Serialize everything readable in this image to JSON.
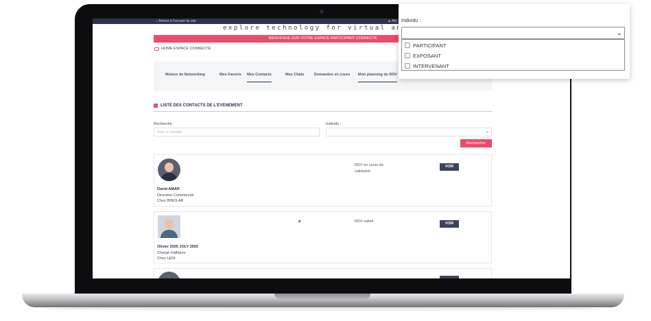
{
  "site": {
    "back_link": "Retour à l'accueil du site",
    "account": "Mo",
    "tagline": "explore technology for virtual and hybrid ev",
    "welcome_banner": "BIENVENUE SUR VOTRE ESPACE PARTICIPANT CONNECTÉ",
    "home_link": "HOME ESPACE CONNECTÉ",
    "accent_color": "#ee4a6a",
    "navy_color": "#2e3349"
  },
  "nav": {
    "tabs": [
      {
        "label": "Moteur de Networking"
      },
      {
        "label": "Mes Favoris"
      },
      {
        "label": "Mes Contacts",
        "active": true
      },
      {
        "label": "Mes Chats"
      },
      {
        "label": "Demandes en cours"
      },
      {
        "label": "Mon planning de RDV",
        "active": true
      }
    ]
  },
  "section": {
    "title": "LISTE DES CONTACTS DE L'EVENEMENT"
  },
  "filters": {
    "search_label": "Recherche :",
    "search_placeholder": "Nom ou Société",
    "individu_label": "Individu :",
    "search_button": "Rechercher"
  },
  "contacts": [
    {
      "name": "David AMAR",
      "title": "Directeur Commercial",
      "company": "Chez BINOLAR",
      "status": "RDV en cours de validation",
      "marker": "",
      "button": "VOIR"
    },
    {
      "name": "Olivier 2505 JOLY 2505",
      "title": "Chargé d'affaires",
      "company": "Chez LENI",
      "status": "RDV validé",
      "marker": "P",
      "button": "VOIR"
    }
  ],
  "dropdown": {
    "label": "Individu :",
    "options": [
      {
        "label": "PARTICIPANT"
      },
      {
        "label": "EXPOSANT"
      },
      {
        "label": "INTERVENANT"
      }
    ]
  }
}
